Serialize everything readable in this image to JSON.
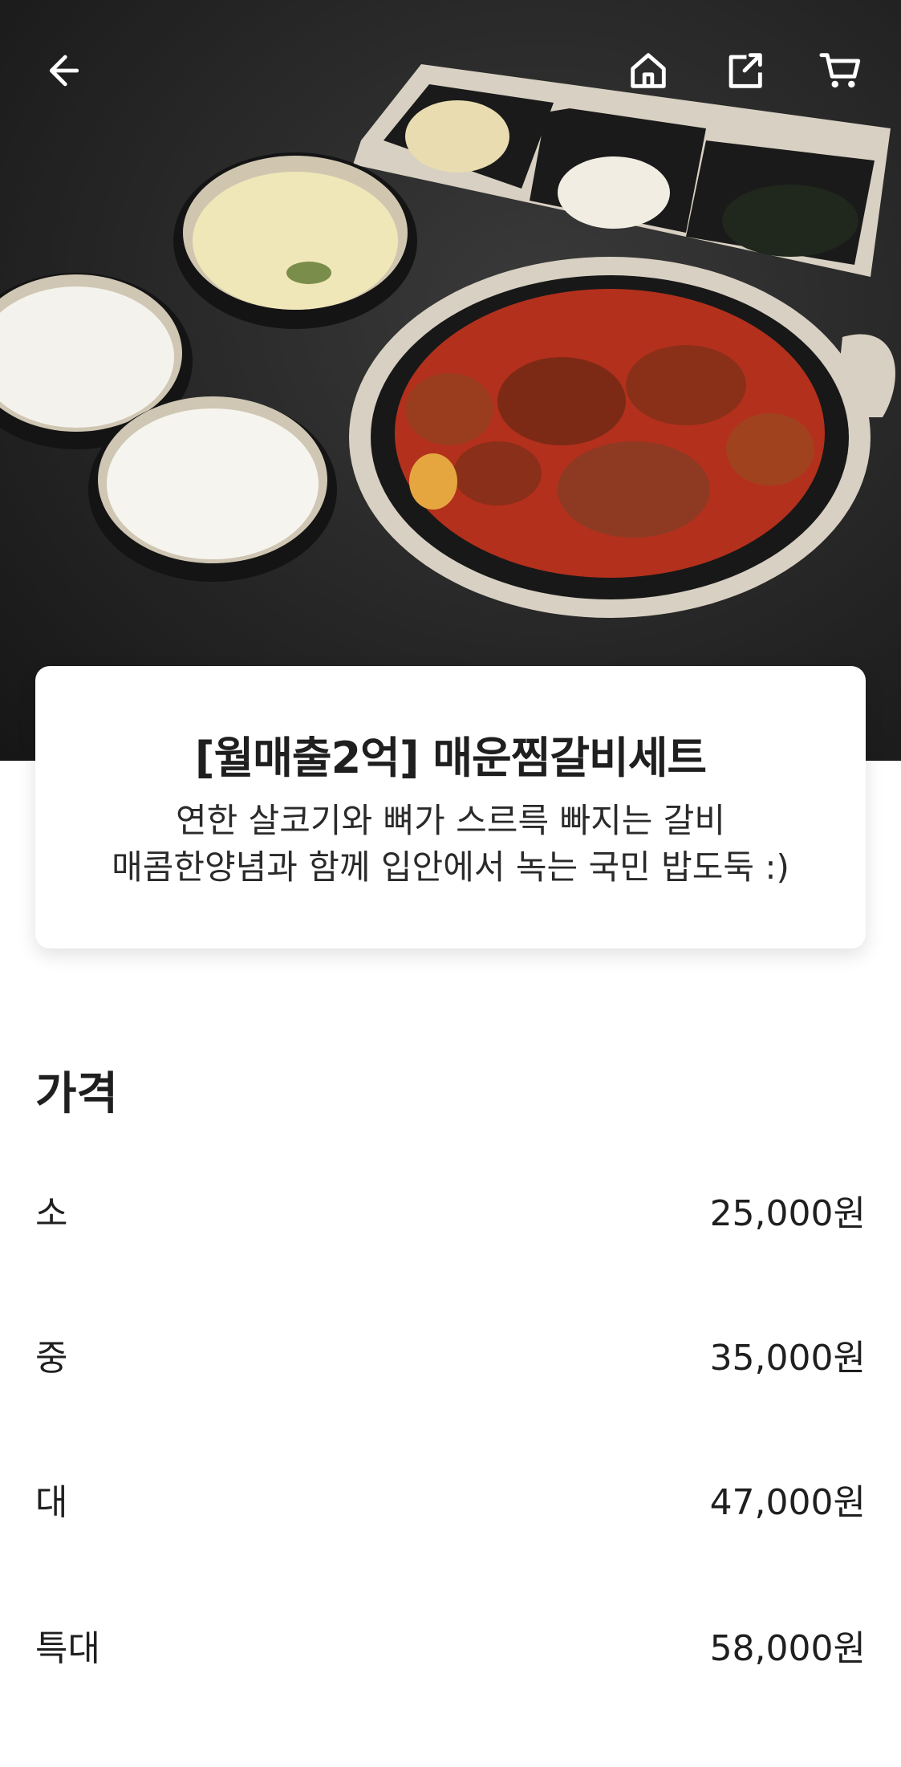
{
  "product": {
    "title": "[월매출2억] 매운찜갈비세트",
    "description_line1": "연한 살코기와 뼈가 스르륵 빠지는 갈비",
    "description_line2": "매콤한양념과 함께 입안에서 녹는 국민 밥도둑 :)"
  },
  "icons": {
    "back": "arrow-left-icon",
    "home": "home-icon",
    "share": "share-icon",
    "cart": "cart-icon"
  },
  "price_section": {
    "heading": "가격",
    "rows": [
      {
        "size": "소",
        "price": "25,000원"
      },
      {
        "size": "중",
        "price": "35,000원"
      },
      {
        "size": "대",
        "price": "47,000원"
      },
      {
        "size": "특대",
        "price": "58,000원"
      }
    ]
  }
}
